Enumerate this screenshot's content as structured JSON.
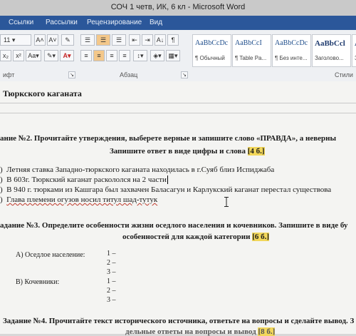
{
  "window": {
    "title": "СОЧ 1 четв, ИК, 6 кл - Microsoft Word"
  },
  "ribbon_tabs": [
    "Ссылки",
    "Рассылки",
    "Рецензирование",
    "Вид"
  ],
  "font": {
    "size": "11"
  },
  "styles": [
    {
      "sample": "AaBbCcDc",
      "name": "¶ Обычный"
    },
    {
      "sample": "AaBbCcI",
      "name": "¶ Table Pa..."
    },
    {
      "sample": "AaBbCcDc",
      "name": "¶ Без инте..."
    },
    {
      "sample": "AaBbCcl",
      "name": "Заголово..."
    },
    {
      "sample": "A",
      "name": "З"
    }
  ],
  "groups": {
    "font": "ифт",
    "paragraph": "Абзац",
    "styles": "Стили"
  },
  "doc": {
    "heading_tail": "Тюркского каганата",
    "task2": {
      "title": "ание №2. Прочитайте утверждения, выберете верные и запишите слово «ПРАВДА», а неверны",
      "sub": "Запишите ответ в виде цифры и слова",
      "points": "[4 б.]",
      "items": [
        "Летняя ставка Западно-тюркского каганата находилась в г.Суяб близ Испиджаба",
        "В 603г. Тюркский каганат раскололся на 2 части",
        "В 940 г. тюрками из Кашгара был захвачен Баласагун и Карлукский каганат перестал существова",
        "Глава племени огузов носил титул шад-тутук"
      ],
      "markers": [
        ")",
        ")",
        ")",
        ")"
      ]
    },
    "task3": {
      "title": "адание №3. Определите особенности жизни оседлого населения и кочевников. Запишите в виде бу",
      "sub": "особенностей для каждой категории",
      "points": "[6 б.]",
      "cat_a": "А) Оседлое население:",
      "cat_b": "В) Кочевники:",
      "blanks_a": [
        "1 –",
        "2 –",
        "3 –"
      ],
      "blanks_b": [
        "1 –",
        "2 –",
        "3 –"
      ]
    },
    "task4": {
      "title": "Задание №4. Прочитайте текст исторического источника, ответьте на вопросы и сделайте вывод. З",
      "sub": "дельные ответы на вопросы и вывод",
      "points": "[8 б.]"
    }
  },
  "colors": {
    "ribbon_tab_bg": "#2b579a",
    "highlight": "#f2d75a"
  }
}
